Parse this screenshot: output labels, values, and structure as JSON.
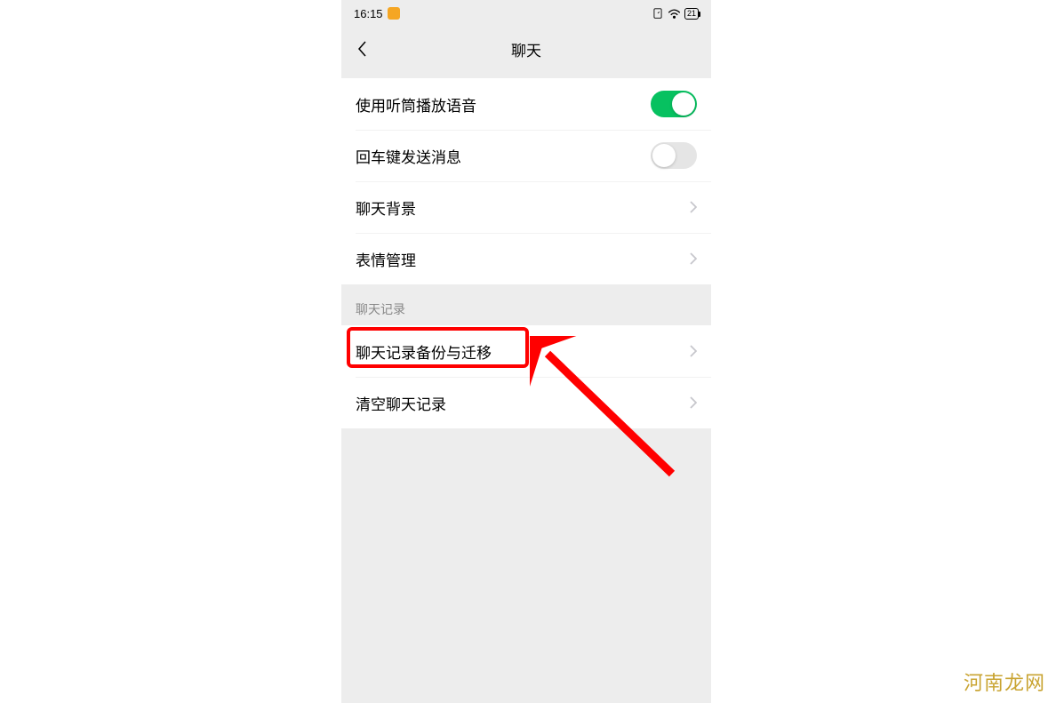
{
  "status": {
    "time": "16:15",
    "battery": "21"
  },
  "header": {
    "title": "聊天"
  },
  "rows": {
    "voice_speaker": "使用听筒播放语音",
    "enter_send": "回车键发送消息",
    "chat_bg": "聊天背景",
    "emoji_mgmt": "表情管理",
    "section_records": "聊天记录",
    "backup_migrate": "聊天记录备份与迁移",
    "clear_records": "清空聊天记录"
  },
  "watermark": "河南龙网"
}
